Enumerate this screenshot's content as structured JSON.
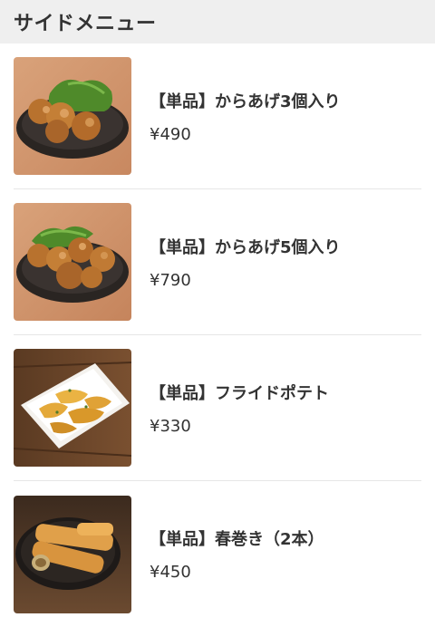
{
  "header": {
    "title": "サイドメニュー"
  },
  "items": [
    {
      "name": "【単品】からあげ3個入り",
      "price": "¥490",
      "image": "karaage-3-photo"
    },
    {
      "name": "【単品】からあげ5個入り",
      "price": "¥790",
      "image": "karaage-5-photo"
    },
    {
      "name": "【単品】フライドポテト",
      "price": "¥330",
      "image": "fried-potato-photo"
    },
    {
      "name": "【単品】春巻き（2本）",
      "price": "¥450",
      "image": "spring-roll-photo"
    }
  ]
}
